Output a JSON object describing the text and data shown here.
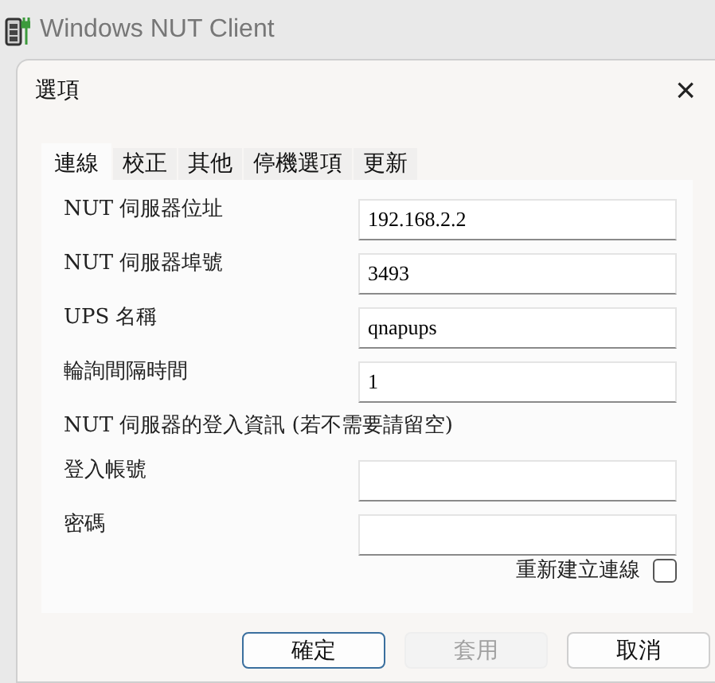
{
  "window": {
    "title": "Windows NUT Client"
  },
  "dialog": {
    "title": "選項",
    "close": "×"
  },
  "tabs": [
    {
      "label": "連線",
      "selected": true
    },
    {
      "label": "校正",
      "selected": false
    },
    {
      "label": "其他",
      "selected": false
    },
    {
      "label": "停機選項",
      "selected": false
    },
    {
      "label": "更新",
      "selected": false
    }
  ],
  "fields": [
    {
      "label": "NUT 伺服器位址",
      "value": "192.168.2.2"
    },
    {
      "label": "NUT 伺服器埠號",
      "value": "3493"
    },
    {
      "label": "UPS 名稱",
      "value": "qnapups"
    },
    {
      "label": "輪詢間隔時間",
      "value": "1"
    }
  ],
  "login_note": "NUT 伺服器的登入資訊 (若不需要請留空)",
  "login_fields": [
    {
      "label": "登入帳號"
    },
    {
      "label": "密碼"
    }
  ],
  "reconnect": {
    "label": "重新建立連線",
    "checked": false
  },
  "buttons": [
    {
      "label": "確定",
      "disabled": false,
      "selected": true
    },
    {
      "label": "套用",
      "disabled": true,
      "selected": false
    },
    {
      "label": "取消",
      "disabled": false,
      "selected": false
    }
  ]
}
